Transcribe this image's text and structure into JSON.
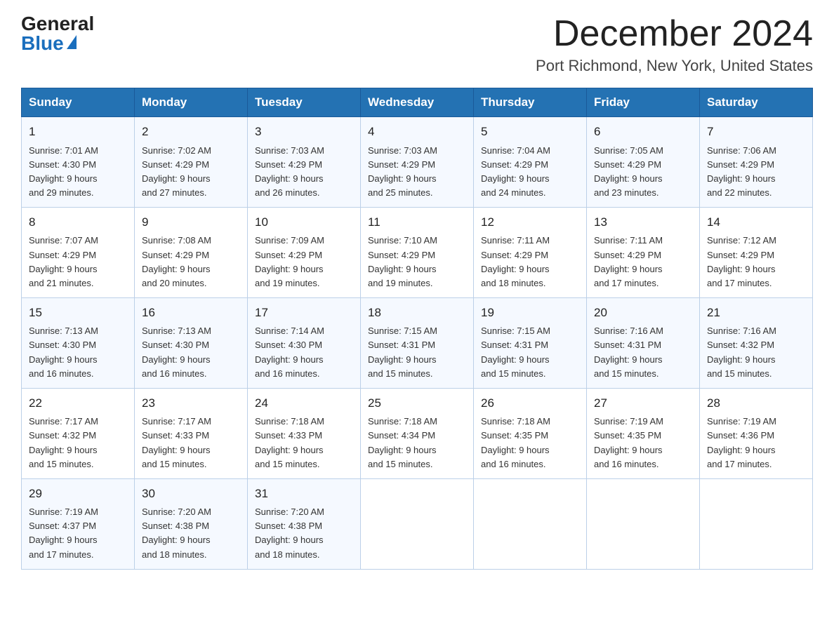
{
  "header": {
    "logo_general": "General",
    "logo_blue": "Blue",
    "month_title": "December 2024",
    "location": "Port Richmond, New York, United States"
  },
  "days_of_week": [
    "Sunday",
    "Monday",
    "Tuesday",
    "Wednesday",
    "Thursday",
    "Friday",
    "Saturday"
  ],
  "weeks": [
    [
      {
        "day": "1",
        "sunrise": "7:01 AM",
        "sunset": "4:30 PM",
        "daylight": "9 hours and 29 minutes."
      },
      {
        "day": "2",
        "sunrise": "7:02 AM",
        "sunset": "4:29 PM",
        "daylight": "9 hours and 27 minutes."
      },
      {
        "day": "3",
        "sunrise": "7:03 AM",
        "sunset": "4:29 PM",
        "daylight": "9 hours and 26 minutes."
      },
      {
        "day": "4",
        "sunrise": "7:03 AM",
        "sunset": "4:29 PM",
        "daylight": "9 hours and 25 minutes."
      },
      {
        "day": "5",
        "sunrise": "7:04 AM",
        "sunset": "4:29 PM",
        "daylight": "9 hours and 24 minutes."
      },
      {
        "day": "6",
        "sunrise": "7:05 AM",
        "sunset": "4:29 PM",
        "daylight": "9 hours and 23 minutes."
      },
      {
        "day": "7",
        "sunrise": "7:06 AM",
        "sunset": "4:29 PM",
        "daylight": "9 hours and 22 minutes."
      }
    ],
    [
      {
        "day": "8",
        "sunrise": "7:07 AM",
        "sunset": "4:29 PM",
        "daylight": "9 hours and 21 minutes."
      },
      {
        "day": "9",
        "sunrise": "7:08 AM",
        "sunset": "4:29 PM",
        "daylight": "9 hours and 20 minutes."
      },
      {
        "day": "10",
        "sunrise": "7:09 AM",
        "sunset": "4:29 PM",
        "daylight": "9 hours and 19 minutes."
      },
      {
        "day": "11",
        "sunrise": "7:10 AM",
        "sunset": "4:29 PM",
        "daylight": "9 hours and 19 minutes."
      },
      {
        "day": "12",
        "sunrise": "7:11 AM",
        "sunset": "4:29 PM",
        "daylight": "9 hours and 18 minutes."
      },
      {
        "day": "13",
        "sunrise": "7:11 AM",
        "sunset": "4:29 PM",
        "daylight": "9 hours and 17 minutes."
      },
      {
        "day": "14",
        "sunrise": "7:12 AM",
        "sunset": "4:29 PM",
        "daylight": "9 hours and 17 minutes."
      }
    ],
    [
      {
        "day": "15",
        "sunrise": "7:13 AM",
        "sunset": "4:30 PM",
        "daylight": "9 hours and 16 minutes."
      },
      {
        "day": "16",
        "sunrise": "7:13 AM",
        "sunset": "4:30 PM",
        "daylight": "9 hours and 16 minutes."
      },
      {
        "day": "17",
        "sunrise": "7:14 AM",
        "sunset": "4:30 PM",
        "daylight": "9 hours and 16 minutes."
      },
      {
        "day": "18",
        "sunrise": "7:15 AM",
        "sunset": "4:31 PM",
        "daylight": "9 hours and 15 minutes."
      },
      {
        "day": "19",
        "sunrise": "7:15 AM",
        "sunset": "4:31 PM",
        "daylight": "9 hours and 15 minutes."
      },
      {
        "day": "20",
        "sunrise": "7:16 AM",
        "sunset": "4:31 PM",
        "daylight": "9 hours and 15 minutes."
      },
      {
        "day": "21",
        "sunrise": "7:16 AM",
        "sunset": "4:32 PM",
        "daylight": "9 hours and 15 minutes."
      }
    ],
    [
      {
        "day": "22",
        "sunrise": "7:17 AM",
        "sunset": "4:32 PM",
        "daylight": "9 hours and 15 minutes."
      },
      {
        "day": "23",
        "sunrise": "7:17 AM",
        "sunset": "4:33 PM",
        "daylight": "9 hours and 15 minutes."
      },
      {
        "day": "24",
        "sunrise": "7:18 AM",
        "sunset": "4:33 PM",
        "daylight": "9 hours and 15 minutes."
      },
      {
        "day": "25",
        "sunrise": "7:18 AM",
        "sunset": "4:34 PM",
        "daylight": "9 hours and 15 minutes."
      },
      {
        "day": "26",
        "sunrise": "7:18 AM",
        "sunset": "4:35 PM",
        "daylight": "9 hours and 16 minutes."
      },
      {
        "day": "27",
        "sunrise": "7:19 AM",
        "sunset": "4:35 PM",
        "daylight": "9 hours and 16 minutes."
      },
      {
        "day": "28",
        "sunrise": "7:19 AM",
        "sunset": "4:36 PM",
        "daylight": "9 hours and 17 minutes."
      }
    ],
    [
      {
        "day": "29",
        "sunrise": "7:19 AM",
        "sunset": "4:37 PM",
        "daylight": "9 hours and 17 minutes."
      },
      {
        "day": "30",
        "sunrise": "7:20 AM",
        "sunset": "4:38 PM",
        "daylight": "9 hours and 18 minutes."
      },
      {
        "day": "31",
        "sunrise": "7:20 AM",
        "sunset": "4:38 PM",
        "daylight": "9 hours and 18 minutes."
      },
      null,
      null,
      null,
      null
    ]
  ]
}
